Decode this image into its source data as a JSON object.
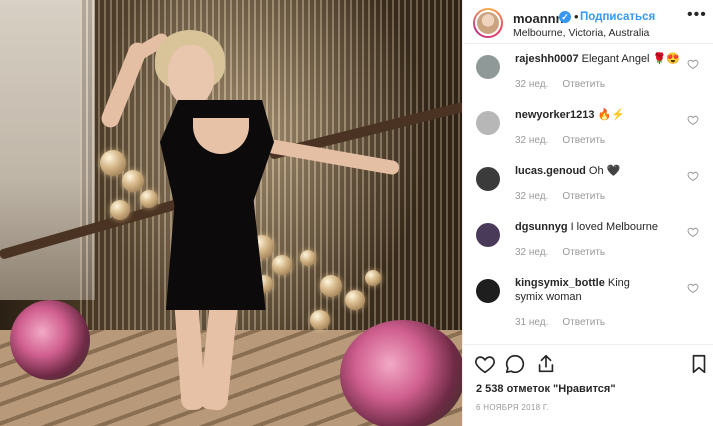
{
  "post": {
    "username": "moannn",
    "verified_mark": "✓",
    "separator": "•",
    "follow_label": "Подписаться",
    "more_label": "•••",
    "location": "Melbourne, Victoria, Australia"
  },
  "photo": {
    "description_icon": "post-photo"
  },
  "comments": [
    {
      "user": "rajeshh0007",
      "text": "Elegant Angel 🌹😍",
      "time": "32 нед.",
      "reply": "Ответить",
      "avatar_color": "#8f9a98"
    },
    {
      "user": "newyorker1213",
      "text": "🔥⚡",
      "time": "32 нед.",
      "reply": "Ответить",
      "avatar_color": "#b7b7b7"
    },
    {
      "user": "lucas.genoud",
      "text": "Oh 🖤",
      "time": "32 нед.",
      "reply": "Ответить",
      "avatar_color": "#3b3b3b"
    },
    {
      "user": "dgsunnyg",
      "text": "I loved Melbourne",
      "time": "32 нед.",
      "reply": "Ответить",
      "avatar_color": "#4a3a5a"
    },
    {
      "user": "kingsymix_bottle",
      "text": "King symix woman",
      "time": "31 нед.",
      "reply": "Ответить",
      "avatar_color": "#1e1e1e"
    }
  ],
  "actions": {
    "likes_text": "2 538 отметок \"Нравится\"",
    "date_text": "6 НОЯБРЯ 2018 Г."
  },
  "colors": {
    "accent": "#3897f0",
    "text": "#262626",
    "muted": "#999999",
    "border": "#efefef"
  }
}
